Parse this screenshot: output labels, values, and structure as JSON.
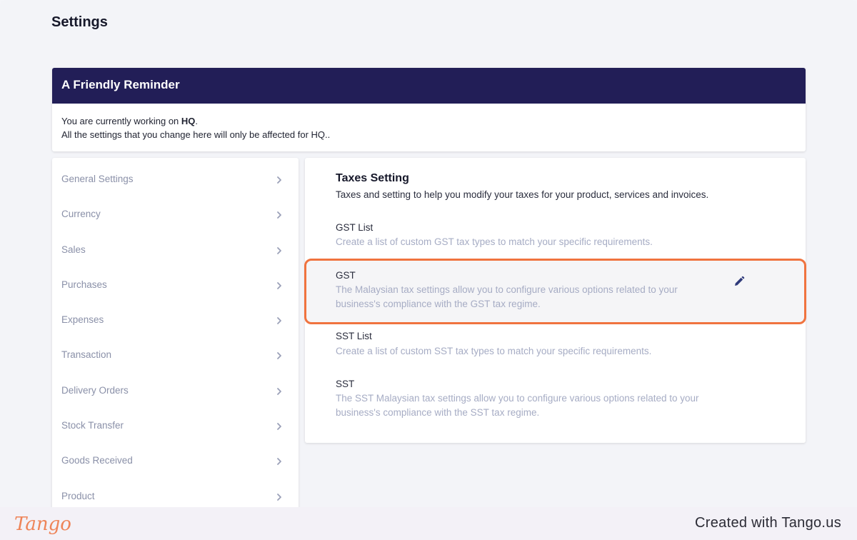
{
  "page": {
    "title": "Settings"
  },
  "reminder": {
    "heading": "A Friendly Reminder",
    "line1_prefix": "You are currently working on ",
    "line1_bold": "HQ",
    "line1_suffix": ".",
    "line2": "All the settings that you change here will only be affected for HQ.."
  },
  "sidebar": {
    "items": [
      {
        "label": "General Settings",
        "icon": "chevron-right-icon"
      },
      {
        "label": "Currency",
        "icon": "chevron-right-icon"
      },
      {
        "label": "Sales",
        "icon": "chevron-right-icon"
      },
      {
        "label": "Purchases",
        "icon": "chevron-right-icon"
      },
      {
        "label": "Expenses",
        "icon": "chevron-right-icon"
      },
      {
        "label": "Transaction",
        "icon": "chevron-right-icon"
      },
      {
        "label": "Delivery Orders",
        "icon": "chevron-right-icon"
      },
      {
        "label": "Stock Transfer",
        "icon": "chevron-right-icon"
      },
      {
        "label": "Goods Received",
        "icon": "chevron-right-icon"
      },
      {
        "label": "Product",
        "icon": "chevron-right-icon"
      }
    ]
  },
  "taxes": {
    "title": "Taxes Setting",
    "subtitle": "Taxes and setting to help you modify your taxes for your product, services and invoices.",
    "options": [
      {
        "name": "GST List",
        "desc": "Create a list of custom GST tax types to match your specific requirements."
      },
      {
        "name": "GST",
        "desc": "The Malaysian tax settings allow you to configure various options related to your business's compliance with the GST tax regime.",
        "icon": "pencil-icon"
      },
      {
        "name": "SST List",
        "desc": "Create a list of custom SST tax types to match your specific requirements."
      },
      {
        "name": "SST",
        "desc": "The SST Malaysian tax settings allow you to configure various options related to your business's compliance with the SST tax regime."
      }
    ]
  },
  "footer": {
    "logo": "Tango",
    "credit": "Created with Tango.us"
  },
  "colors": {
    "header_bg": "#221e57",
    "highlight_border": "#f0733f",
    "muted_text": "#a6acc4",
    "edit_icon": "#2f3a7a"
  }
}
